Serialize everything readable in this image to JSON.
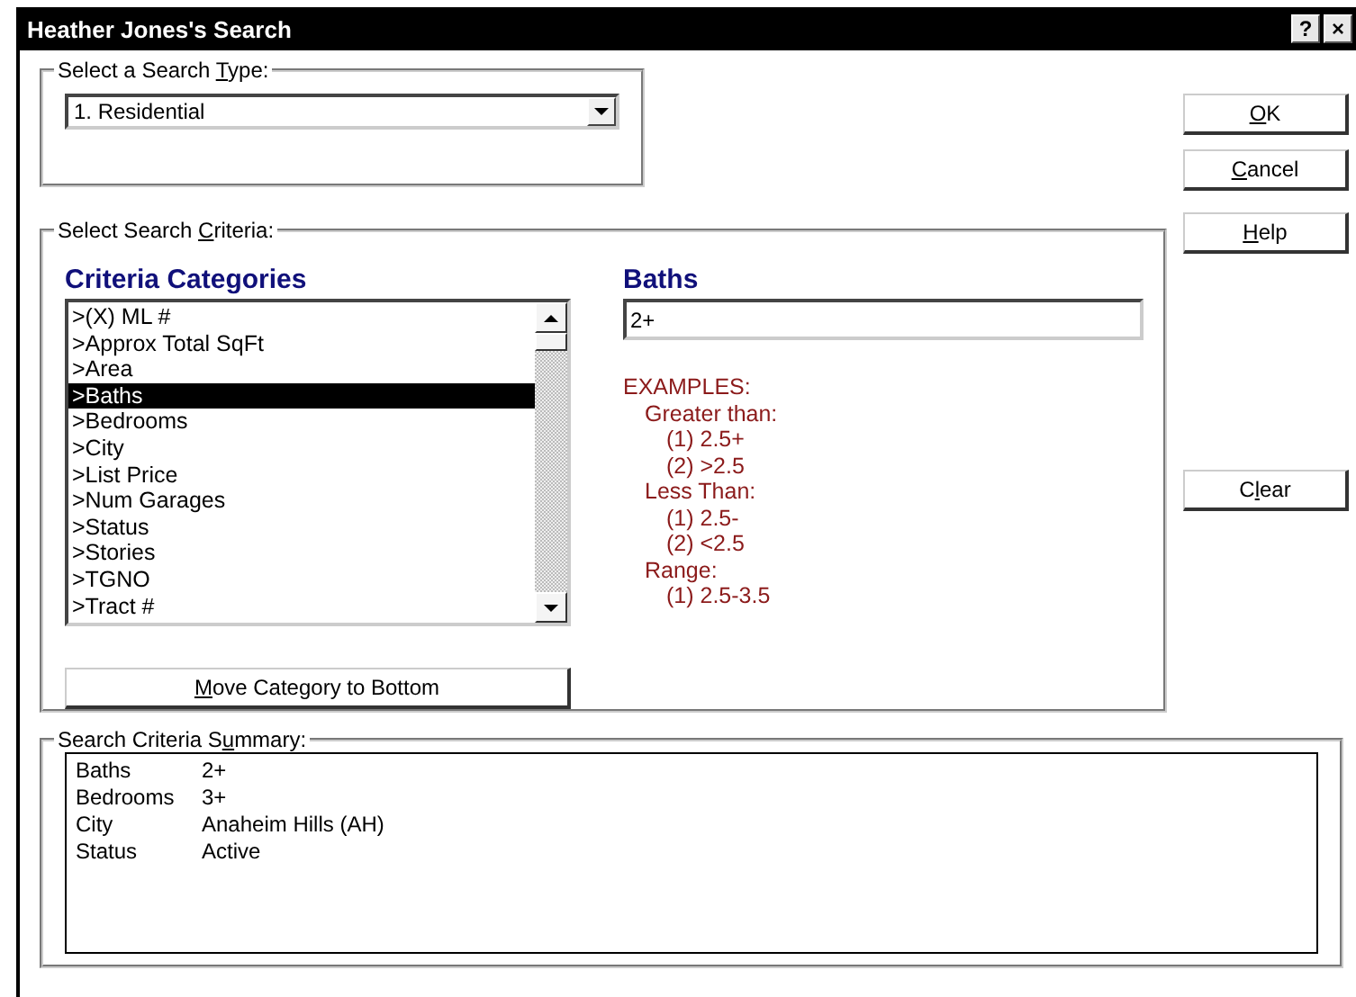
{
  "window": {
    "title": "Heather Jones's Search",
    "title_buttons": [
      "?",
      "×"
    ]
  },
  "search_type": {
    "label_parts": {
      "before": "Select a Search ",
      "key": "T",
      "after": "ype:"
    },
    "value": "1. Residential"
  },
  "criteria": {
    "label_parts": {
      "before": "Select Search ",
      "key": "C",
      "after": "riteria:"
    },
    "categories_heading": "Criteria Categories",
    "categories": [
      {
        "label": ">(X) ML #",
        "selected": false
      },
      {
        "label": ">Approx Total SqFt",
        "selected": false
      },
      {
        "label": ">Area",
        "selected": false
      },
      {
        "label": ">Baths",
        "selected": true
      },
      {
        "label": ">Bedrooms",
        "selected": false
      },
      {
        "label": ">City",
        "selected": false
      },
      {
        "label": ">List Price",
        "selected": false
      },
      {
        "label": ">Num Garages",
        "selected": false
      },
      {
        "label": ">Status",
        "selected": false
      },
      {
        "label": ">Stories",
        "selected": false
      },
      {
        "label": ">TGNO",
        "selected": false
      },
      {
        "label": ">Tract #",
        "selected": false
      }
    ],
    "move_button": {
      "key": "M",
      "after": "ove Category to Bottom"
    },
    "field_heading": "Baths",
    "field_value": "2+",
    "examples": [
      {
        "text": "EXAMPLES:",
        "children": [
          {
            "text": "Greater than:",
            "children": [
              {
                "text": "(1) 2.5+"
              },
              {
                "text": "(2) >2.5"
              }
            ]
          },
          {
            "text": "Less Than:",
            "children": [
              {
                "text": "(1) 2.5-"
              },
              {
                "text": "(2) <2.5"
              }
            ]
          },
          {
            "text": "Range:",
            "children": [
              {
                "text": "(1) 2.5-3.5"
              }
            ]
          }
        ]
      }
    ]
  },
  "buttons": [
    {
      "parts": {
        "key": "O",
        "after": "K"
      }
    },
    {
      "parts": {
        "key": "C",
        "after": "ancel"
      }
    },
    {
      "parts": {
        "key": "H",
        "after": "elp"
      }
    }
  ],
  "clear_button": {
    "before": "C",
    "key": "l",
    "after": "ear"
  },
  "summary": {
    "label_parts": {
      "before": "Search Criteria S",
      "key": "u",
      "after": "mmary:"
    },
    "rows": [
      {
        "field": "Baths",
        "value": "2+"
      },
      {
        "field": "Bedrooms",
        "value": "3+"
      },
      {
        "field": "City",
        "value": "Anaheim Hills (AH)"
      },
      {
        "field": "Status",
        "value": "Active"
      }
    ]
  }
}
